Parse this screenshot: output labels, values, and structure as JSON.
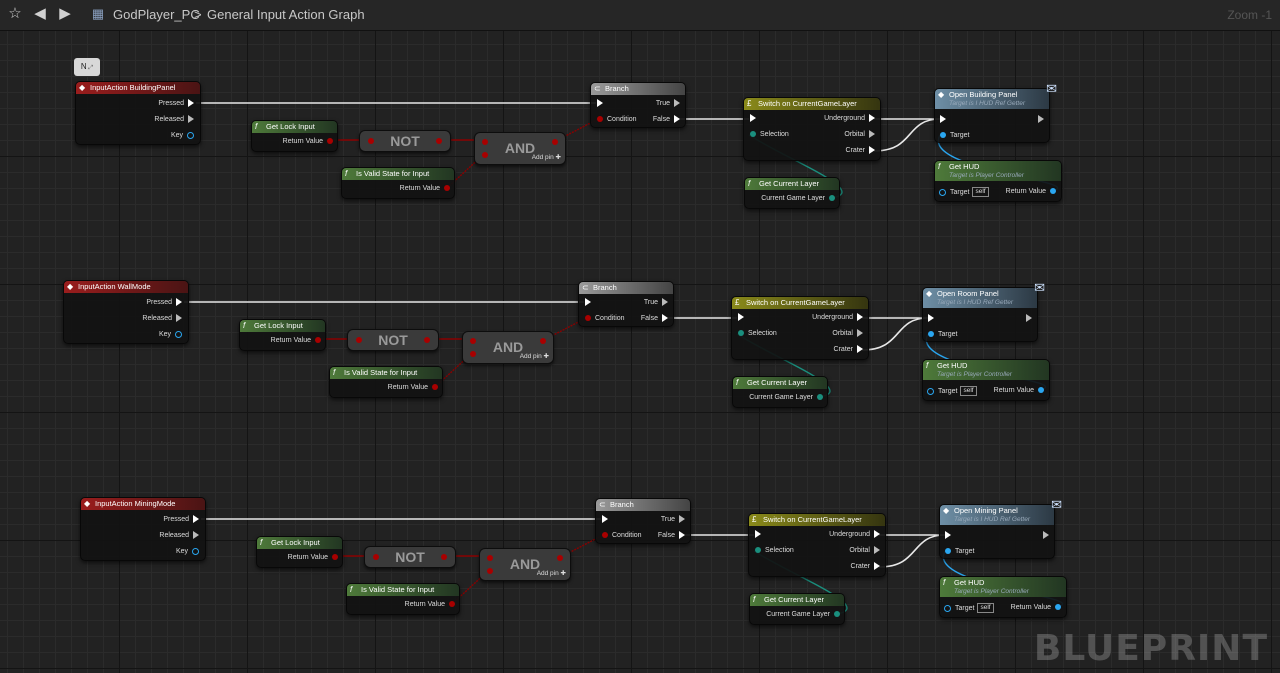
{
  "topbar": {
    "star_icon": "star-icon",
    "back_icon": "back-arrow-icon",
    "forward_icon": "forward-arrow-icon",
    "blueprint_icon": "blueprint-grid-icon",
    "breadcrumb_root": "GodPlayer_PC",
    "breadcrumb_sep": ">",
    "breadcrumb_current": "General Input Action Graph",
    "zoom": "Zoom -1"
  },
  "comment": {
    "label": "N"
  },
  "labels": {
    "pressed": "Pressed",
    "released": "Released",
    "key": "Key",
    "get_lock_input": "Get Lock Input",
    "return_value": "Return Value",
    "not": "NOT",
    "and": "AND",
    "add_pin": "Add pin",
    "is_valid_state": "Is Valid State for Input",
    "branch": "Branch",
    "condition": "Condition",
    "true": "True",
    "false": "False",
    "switch": "Switch on CurrentGameLayer",
    "selection": "Selection",
    "underground": "Underground",
    "orbital": "Orbital",
    "crater": "Crater",
    "get_current_layer": "Get Current Layer",
    "current_game_layer": "Current Game Layer",
    "target": "Target",
    "hud_ref_getter": "Target is I HUD Ref Getter",
    "get_hud": "Get HUD",
    "player_controller": "Target is Player Controller",
    "self": "self"
  },
  "groups": [
    {
      "event": "InputAction BuildingPanel",
      "panel": "Open Building Panel"
    },
    {
      "event": "InputAction WallMode",
      "panel": "Open Room Panel"
    },
    {
      "event": "InputAction MiningMode",
      "panel": "Open Mining Panel"
    }
  ],
  "watermark": "BLUEPRINT",
  "colors": {
    "exec_wire": "#ffffff",
    "bool_wire": "#8a0000",
    "enum_wire": "#1a8f7e",
    "object_wire": "#2aa6f0",
    "event_header": "#9a1d1d",
    "function_header": "#4e7a3a",
    "switch_header": "#8a8a1a",
    "message_header": "#6e8fa6"
  }
}
